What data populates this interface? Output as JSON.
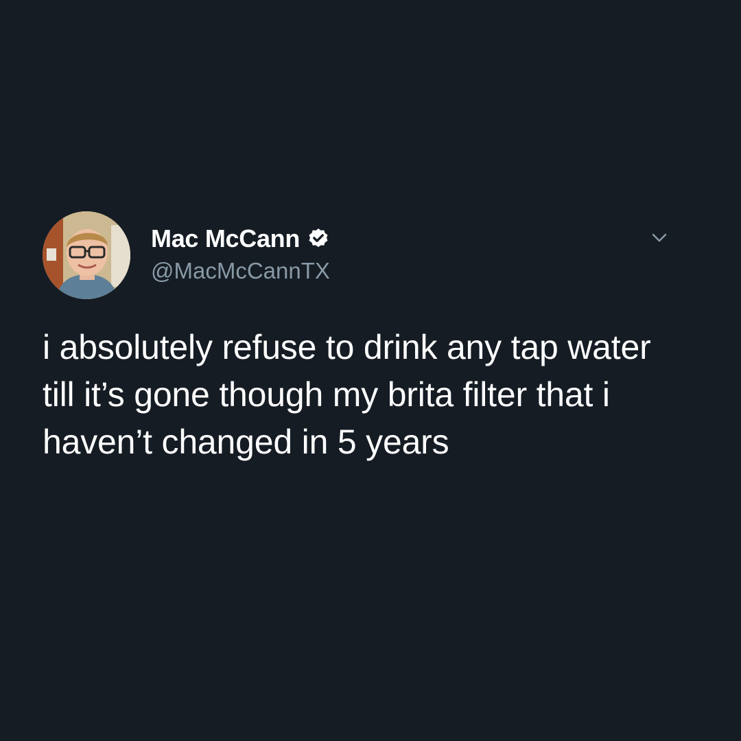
{
  "tweet": {
    "display_name": "Mac McCann",
    "handle": "@MacMcCannTX",
    "text": "i absolutely refuse to drink any tap water till it’s gone though my brita filter that i haven’t changed in 5 years",
    "verified": true
  },
  "icons": {
    "verified": "verified-badge-icon",
    "menu": "chevron-down-icon",
    "avatar": "profile-photo"
  },
  "colors": {
    "background": "#151c24",
    "text_primary": "#ffffff",
    "text_secondary": "#8899a6"
  }
}
